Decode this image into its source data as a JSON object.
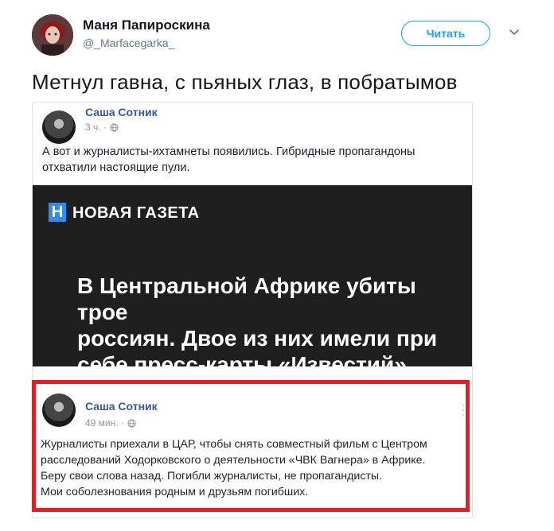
{
  "tweet": {
    "author_name": "Маня Папироскина",
    "author_handle": "@_Marfacegarka_",
    "follow_label": "Читать",
    "text": "Метнул гавна, с пьяных глаз, в побратымов"
  },
  "fb_post_1": {
    "author": "Саша Сотник",
    "time": "3 ч. ·",
    "text_line1": "А вот и журналисты-ихтамнеты появились. Гибридные пропагандоны",
    "text_line2": "отхватили настоящие пули."
  },
  "news_card": {
    "logo_letter": "Н",
    "logo_text": "НОВАЯ ГАЗЕТА",
    "headline_line1": "В Центральной Африке убиты трое",
    "headline_line2": "россиян. Двое из них имели при",
    "headline_line3": "себе пресс-карты «Известий»",
    "background_color": "#1f1f1f",
    "logo_color": "#2f8cf2"
  },
  "fb_post_2": {
    "author": "Саша Сотник",
    "time": "49 мин. ·",
    "text_line1": "Журналисты приехали в ЦАР, чтобы снять совместный фильм с Центром",
    "text_line2": "расследований Ходорковского о деятельности «ЧВК Вагнера» в Африке.",
    "text_line3": "Беру свои слова назад. Погибли журналисты, не пропагандисты.",
    "text_line4": "Мои соболезнования родным и друзьям погибших.",
    "highlight_color": "#e31e24"
  },
  "icons": {
    "chevron": "chevron-down-icon",
    "globe": "globe-icon",
    "more": "more-options-icon"
  }
}
